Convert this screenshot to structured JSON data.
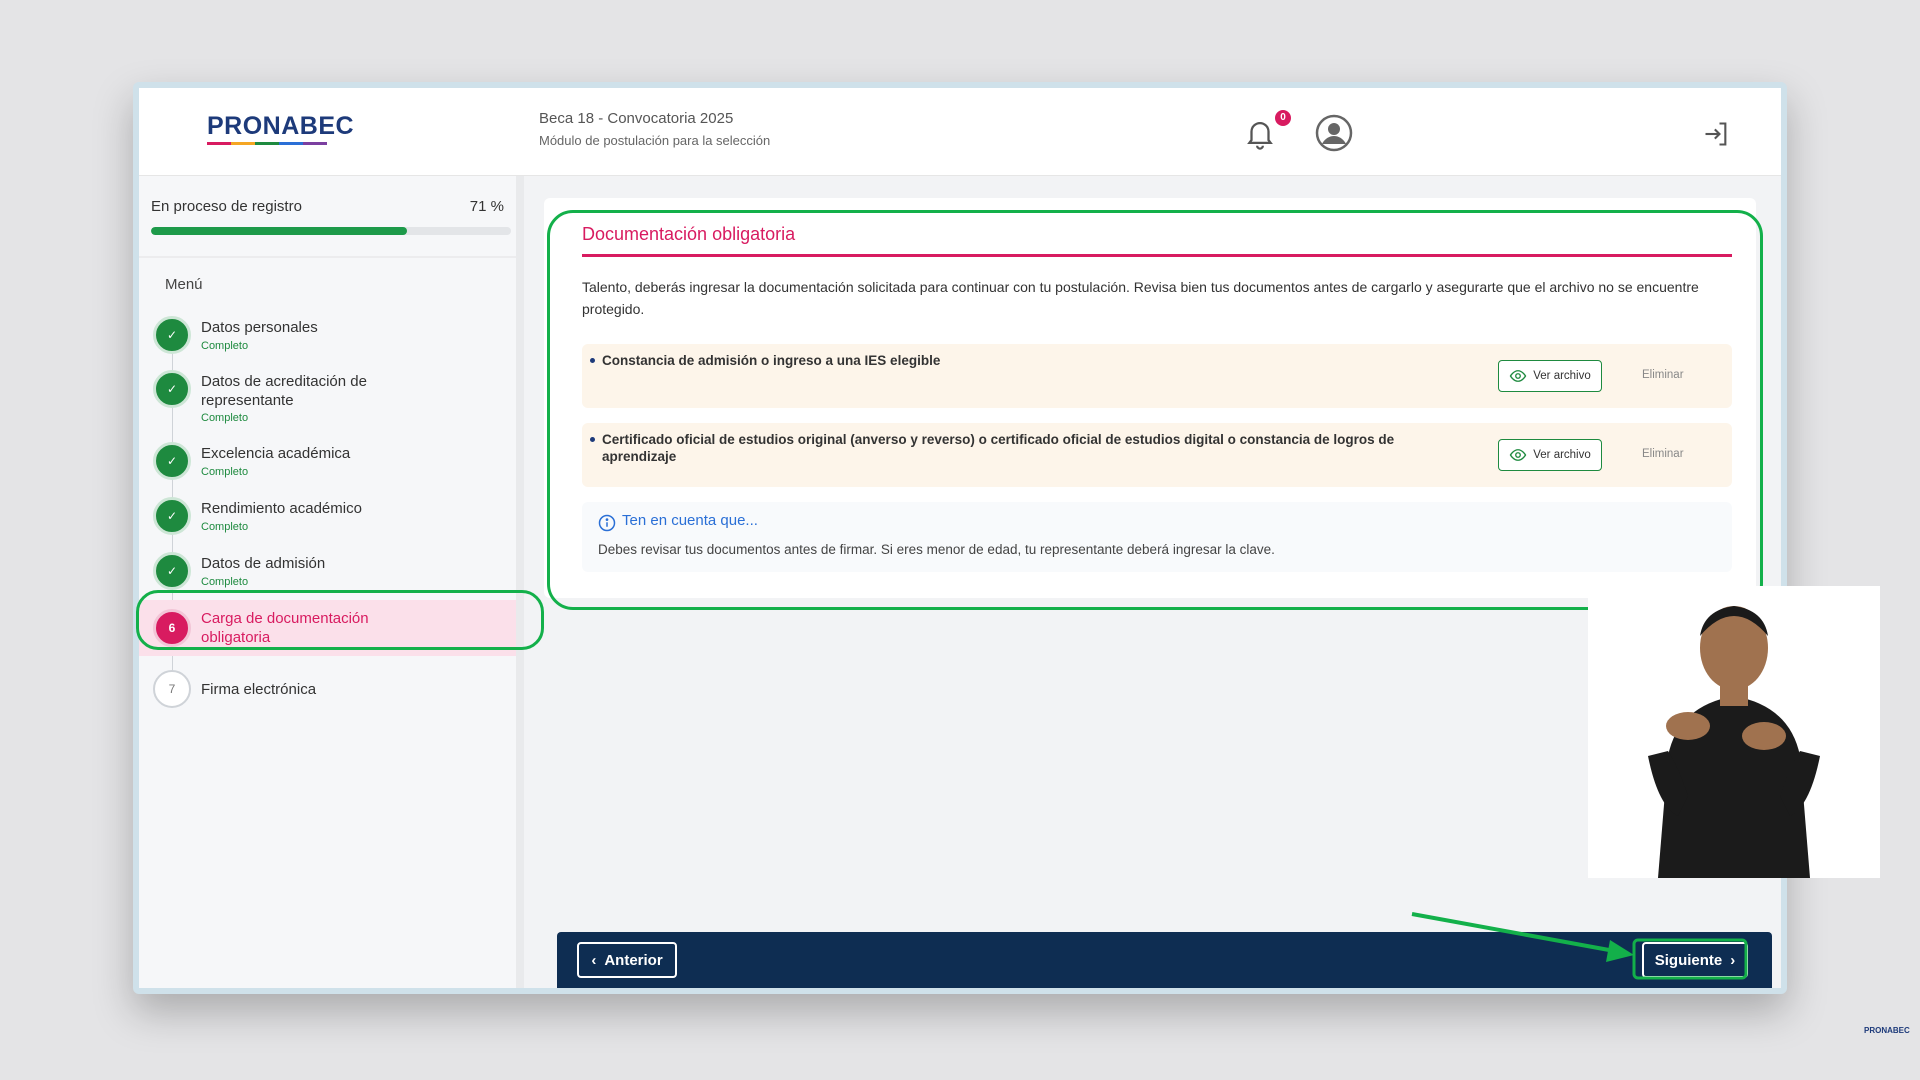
{
  "header": {
    "logo": "PRONABEC",
    "title": "Beca 18 - Convocatoria 2025",
    "subtitle": "Módulo de postulación para la selección",
    "notifications_count": "0",
    "colors": {
      "brand": "#1d3a7a",
      "accent": "#d81b60",
      "success": "#1e8a3f"
    }
  },
  "sidebar": {
    "progress_label": "En proceso de registro",
    "progress_text": "71 %",
    "progress_value": 71,
    "menu_title": "Menú",
    "steps": [
      {
        "title": "Datos personales",
        "status": "Completo",
        "state": "done"
      },
      {
        "title": "Datos de acreditación de representante",
        "status": "Completo",
        "state": "done"
      },
      {
        "title": "Excelencia académica",
        "status": "Completo",
        "state": "done"
      },
      {
        "title": "Rendimiento académico",
        "status": "Completo",
        "state": "done"
      },
      {
        "title": "Datos de admisión",
        "status": "Completo",
        "state": "done"
      },
      {
        "number": "6",
        "title": "Carga de documentación obligatoria",
        "state": "active"
      },
      {
        "number": "7",
        "title": "Firma electrónica",
        "state": "pending"
      }
    ]
  },
  "main": {
    "card_title": "Documentación obligatoria",
    "description": "Talento, deberás ingresar la documentación solicitada para continuar con tu postulación. Revisa bien tus documentos antes de cargarlo y asegurarte que el archivo no se encuentre protegido.",
    "documents": [
      {
        "label": "Constancia de admisión o ingreso a una IES elegible",
        "view_label": "Ver archivo",
        "delete_label": "Eliminar"
      },
      {
        "label": "Certificado oficial de estudios original (anverso y reverso) o certificado oficial de estudios digital o constancia de logros de aprendizaje",
        "view_label": "Ver archivo",
        "delete_label": "Eliminar"
      }
    ],
    "note_title": "Ten en cuenta que...",
    "note_text": "Debes revisar tus documentos antes de firmar. Si eres menor de edad, tu representante deberá ingresar la clave."
  },
  "footer": {
    "prev_label": "Anterior",
    "next_label": "Siguiente"
  },
  "watermark": "PRONABEC"
}
